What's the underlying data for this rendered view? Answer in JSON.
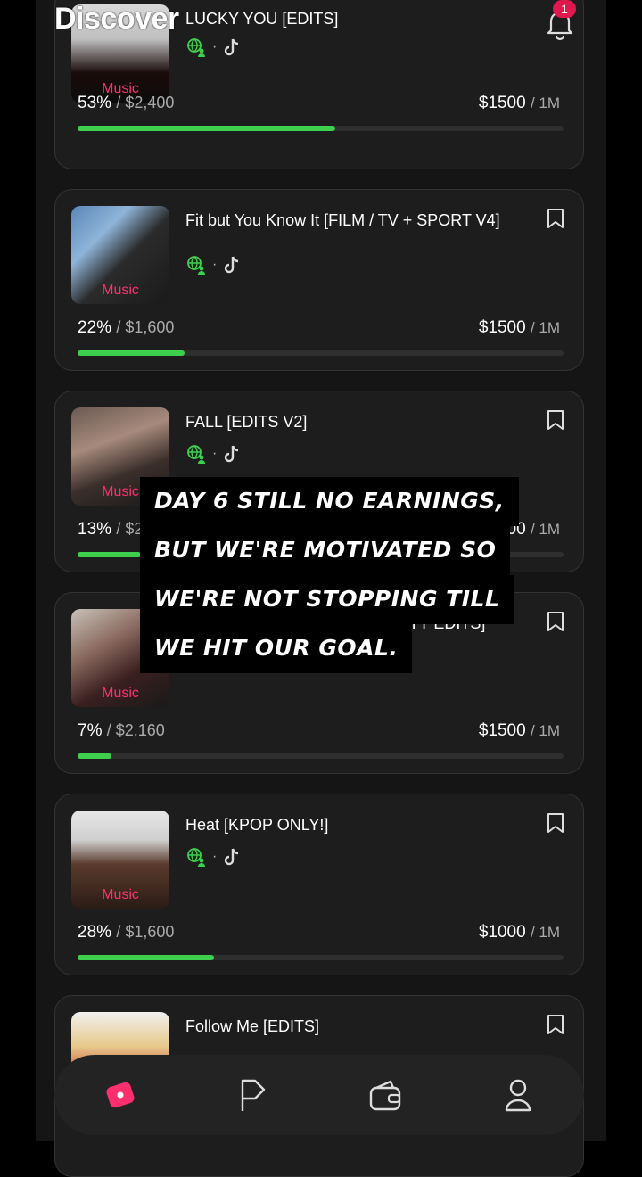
{
  "header": {
    "title": "Discover",
    "notification_count": "1"
  },
  "cards": [
    {
      "title": "LUCKY YOU [EDITS]",
      "tag": "Music",
      "percent": "53%",
      "budget": "/ $2,400",
      "rate": "$1500",
      "per": "/ 1M",
      "progress": 0.53
    },
    {
      "title": "Fit but You Know It [FILM / TV + SPORT V4]",
      "tag": "Music",
      "percent": "22%",
      "budget": "/ $1,600",
      "rate": "$1500",
      "per": "/ 1M",
      "progress": 0.22
    },
    {
      "title": "FALL [EDITS V2]",
      "tag": "Music",
      "percent": "13%",
      "budget": "/ $2",
      "rate": "$1500",
      "per": "/ 1M",
      "progress": 0.13
    },
    {
      "title": "RTY EDITS]",
      "tag": "Music",
      "percent": "7%",
      "budget": "/ $2,160",
      "rate": "$1500",
      "per": "/ 1M",
      "progress": 0.07
    },
    {
      "title": "Heat [KPOP ONLY!]",
      "tag": "Music",
      "percent": "28%",
      "budget": "/ $1,600",
      "rate": "$1000",
      "per": "/ 1M",
      "progress": 0.28
    },
    {
      "title": "Follow Me [EDITS]",
      "tag": "",
      "percent": "",
      "budget": "",
      "rate": "",
      "per": "",
      "progress": 0
    }
  ],
  "caption": {
    "line1": "DAY 6 STILL NO EARNINGS,",
    "line2": "BUT WE'RE MOTIVATED SO",
    "line3": "WE'RE NOT STOPPING TILL",
    "line4": "WE HIT OUR GOAL."
  },
  "nav": {
    "items": [
      "discover-icon",
      "flag-icon",
      "wallet-icon",
      "profile-icon"
    ],
    "active_color": "#ff2f6d"
  },
  "colors": {
    "accent_pink": "#ff2f6d",
    "progress_green": "#3fcf4f",
    "background": "#151515"
  }
}
